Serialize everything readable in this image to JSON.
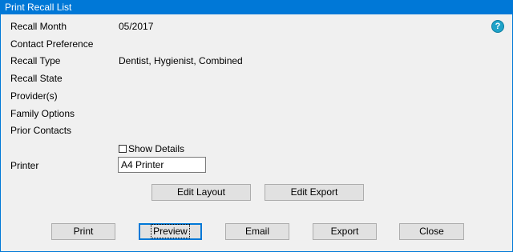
{
  "window": {
    "title": "Print Recall List"
  },
  "help": {
    "icon": "help-icon",
    "glyph": "?",
    "color": "#1fa3c9"
  },
  "fields": [
    {
      "label": "Recall Month",
      "value": "05/2017"
    },
    {
      "label": "Contact Preference",
      "value": ""
    },
    {
      "label": "Recall Type",
      "value": "Dentist, Hygienist, Combined"
    },
    {
      "label": "Recall State",
      "value": ""
    },
    {
      "label": "Provider(s)",
      "value": ""
    },
    {
      "label": "Family Options",
      "value": ""
    },
    {
      "label": "Prior Contacts",
      "value": ""
    }
  ],
  "show_details": {
    "label": "Show Details",
    "checked": false
  },
  "printer": {
    "label": "Printer",
    "value": "A4  Printer"
  },
  "layout_buttons": {
    "edit_layout": "Edit Layout",
    "edit_export": "Edit Export"
  },
  "actions": {
    "print": "Print",
    "preview": "Preview",
    "email": "Email",
    "export": "Export",
    "close": "Close"
  },
  "colors": {
    "titlebar": "#0078d7",
    "background": "#f0f0f0",
    "button": "#e1e1e1",
    "focus": "#0078d7"
  }
}
